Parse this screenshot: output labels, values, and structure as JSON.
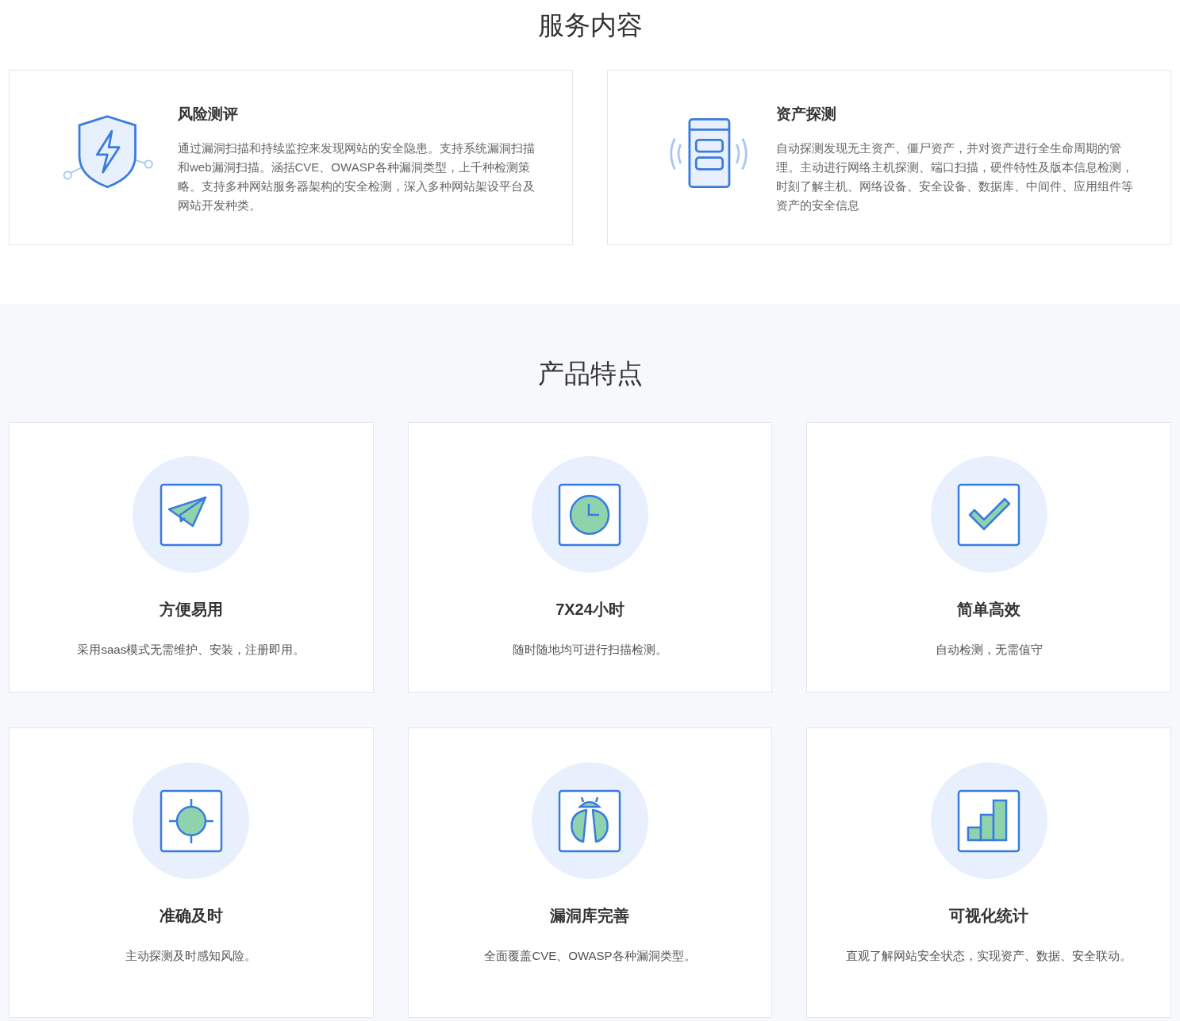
{
  "services": {
    "title": "服务内容",
    "items": [
      {
        "kind": "shield",
        "title": "风险测评",
        "description": "通过漏洞扫描和持续监控来发现网站的安全隐患。支持系统漏洞扫描和web漏洞扫描。涵括CVE、OWASP各种漏洞类型，上千种检测策略。支持多种网站服务器架构的安全检测，深入多种网站架设平台及网站开发种类。"
      },
      {
        "kind": "device",
        "title": "资产探测",
        "description": "自动探测发现无主资产、僵尸资产，并对资产进行全生命周期的管理。主动进行网络主机探测、端口扫描，硬件特性及版本信息检测，时刻了解主机、网络设备、安全设备、数据库、中间件、应用组件等资产的安全信息"
      }
    ]
  },
  "features": {
    "title": "产品特点",
    "items": [
      {
        "kind": "plane",
        "title": "方便易用",
        "description": "采用saas模式无需维护、安装，注册即用。"
      },
      {
        "kind": "clock",
        "title": "7X24小时",
        "description": "随时随地均可进行扫描检测。"
      },
      {
        "kind": "check",
        "title": "简单高效",
        "description": "自动检测，无需值守"
      },
      {
        "kind": "target",
        "title": "准确及时",
        "description": "主动探测及时感知风险。"
      },
      {
        "kind": "bug",
        "title": "漏洞库完善",
        "description": "全面覆盖CVE、OWASP各种漏洞类型。"
      },
      {
        "kind": "chart",
        "title": "可视化统计",
        "description": "直观了解网站安全状态，实现资产、数据、安全联动。"
      }
    ]
  }
}
